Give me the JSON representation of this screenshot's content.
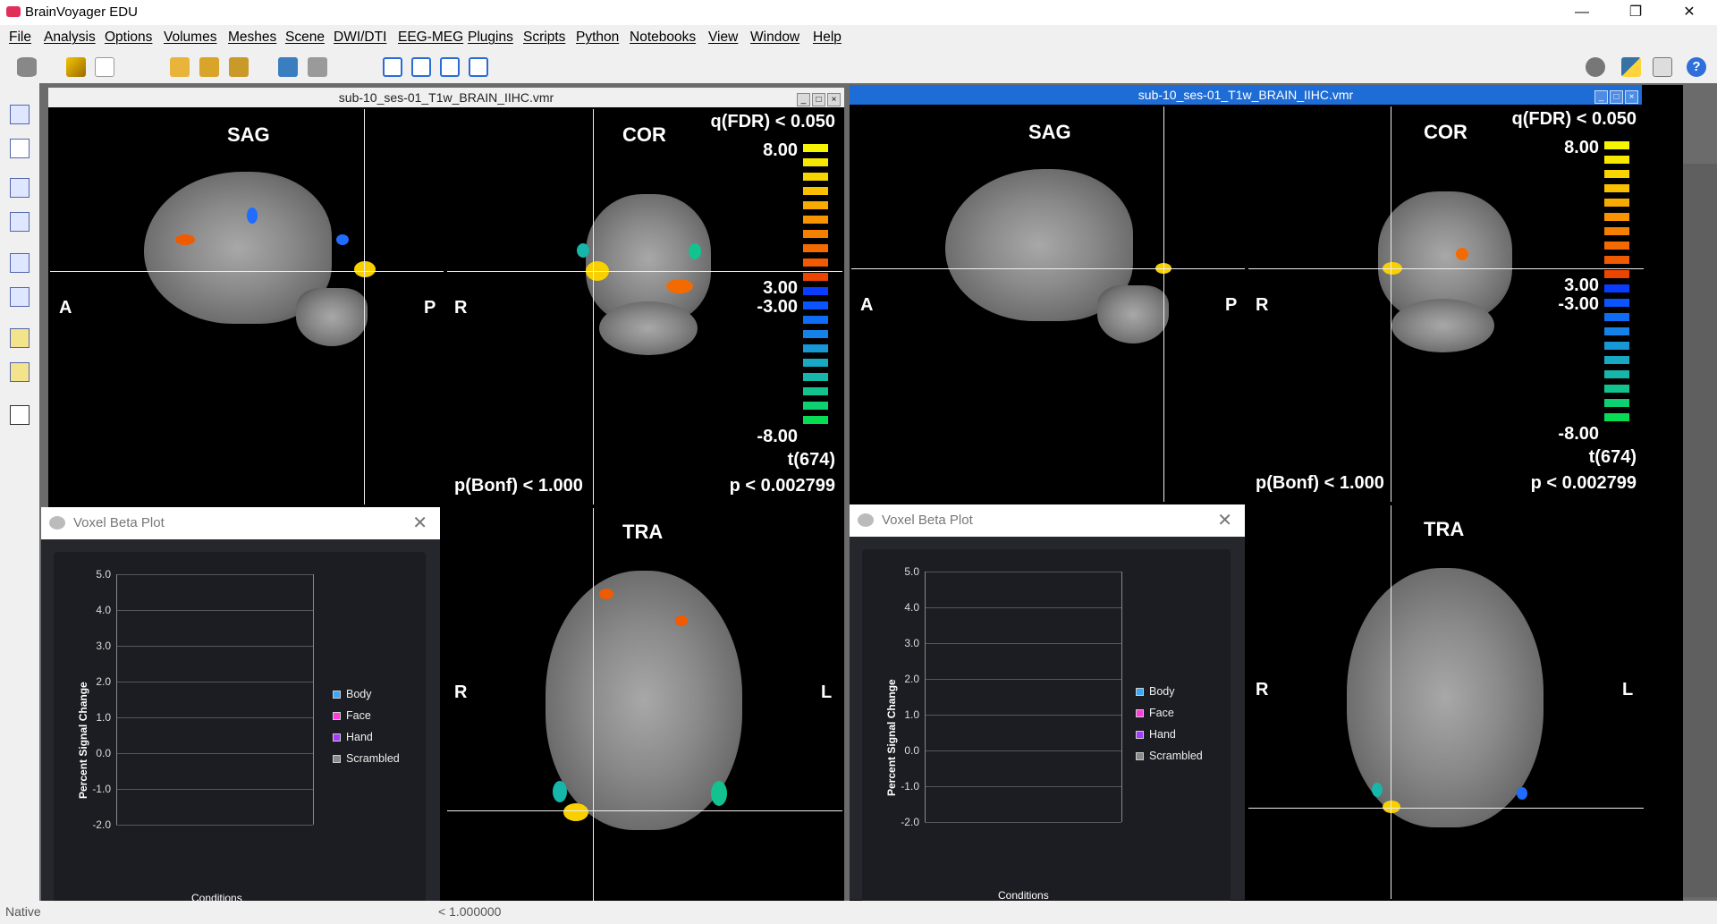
{
  "app": {
    "title": "BrainVoyager EDU"
  },
  "window_controls": {
    "minimize": "—",
    "restore": "❐",
    "close": "✕"
  },
  "menu": [
    "File",
    "Analysis",
    "Options",
    "Volumes",
    "Meshes",
    "Scene",
    "DWI/DTI",
    "EEG-MEG",
    "Plugins",
    "Scripts",
    "Python",
    "Notebooks",
    "View",
    "Window",
    "Help"
  ],
  "toolbar": {
    "icons": [
      "database-icon",
      "wand-icon",
      "new-document-icon",
      "open-folder-icon",
      "new-project-icon",
      "save-icon",
      "link-icon",
      "gallery-icon",
      "window-layout-1-icon",
      "window-layout-2-icon",
      "window-layout-3-icon",
      "window-layout-4-icon"
    ],
    "right_icons": [
      "gear-icon",
      "python-icon",
      "notebook-icon",
      "help-icon"
    ]
  },
  "status": {
    "left": "Native",
    "value": "< 1.000000"
  },
  "windows": [
    {
      "title": "sub-10_ses-01_T1w_BRAIN_IIHC.vmr",
      "active": false,
      "views": {
        "sag": {
          "label": "SAG",
          "left": "A",
          "right": "P"
        },
        "cor": {
          "label": "COR",
          "left": "R"
        },
        "tra": {
          "label": "TRA",
          "left": "R",
          "right": "L"
        }
      },
      "stats": {
        "q_fdr": "q(FDR) < 0.050",
        "max_pos": "8.00",
        "min_pos": "3.00",
        "min_neg": "-3.00",
        "max_neg": "-8.00",
        "t_df": "t(674)",
        "p_bonf": "p(Bonf) < 1.000",
        "p_val": "p < 0.002799"
      },
      "beta_plot": {
        "title": "Voxel Beta Plot",
        "close": "✕",
        "chart_data": {
          "type": "bar",
          "ylabel": "Percent Signal Change",
          "xlabel": "Conditions",
          "ylim": [
            -2.0,
            5.0
          ],
          "yticks": [
            "5.0",
            "4.0",
            "3.0",
            "2.0",
            "1.0",
            "0.0",
            "-1.0",
            "-2.0"
          ],
          "series": [
            {
              "name": "Body",
              "color": "#3aa8ff"
            },
            {
              "name": "Face",
              "color": "#ff3be0"
            },
            {
              "name": "Hand",
              "color": "#a43bff"
            },
            {
              "name": "Scrambled",
              "color": "#8a8a8a"
            }
          ]
        }
      }
    },
    {
      "title": "sub-10_ses-01_T1w_BRAIN_IIHC.vmr",
      "active": true,
      "views": {
        "sag": {
          "label": "SAG",
          "left": "A",
          "right": "P"
        },
        "cor": {
          "label": "COR",
          "left": "R"
        },
        "tra": {
          "label": "TRA",
          "left": "R",
          "right": "L"
        }
      },
      "stats": {
        "q_fdr": "q(FDR) < 0.050",
        "max_pos": "8.00",
        "min_pos": "3.00",
        "min_neg": "-3.00",
        "max_neg": "-8.00",
        "t_df": "t(674)",
        "p_bonf": "p(Bonf) < 1.000",
        "p_val": "p < 0.002799"
      },
      "beta_plot": {
        "title": "Voxel Beta Plot",
        "close": "✕",
        "chart_data": {
          "type": "bar",
          "ylabel": "Percent Signal Change",
          "xlabel": "Conditions",
          "ylim": [
            -2.0,
            5.0
          ],
          "yticks": [
            "5.0",
            "4.0",
            "3.0",
            "2.0",
            "1.0",
            "0.0",
            "-1.0",
            "-2.0"
          ],
          "series": [
            {
              "name": "Body",
              "color": "#3aa8ff"
            },
            {
              "name": "Face",
              "color": "#ff3be0"
            },
            {
              "name": "Hand",
              "color": "#a43bff"
            },
            {
              "name": "Scrambled",
              "color": "#8a8a8a"
            }
          ]
        }
      }
    }
  ],
  "colorbar": {
    "positive": [
      "#f6f600",
      "#f8e800",
      "#f9d500",
      "#fac000",
      "#f9aa00",
      "#f79400",
      "#f58000",
      "#f36b00",
      "#f05a00",
      "#ec4500"
    ],
    "negative": [
      "#0a3cff",
      "#0a55ff",
      "#0f6cf5",
      "#1582e8",
      "#1897d6",
      "#19a8c2",
      "#17b6aa",
      "#12c38f",
      "#0dd070",
      "#08dc55"
    ]
  }
}
